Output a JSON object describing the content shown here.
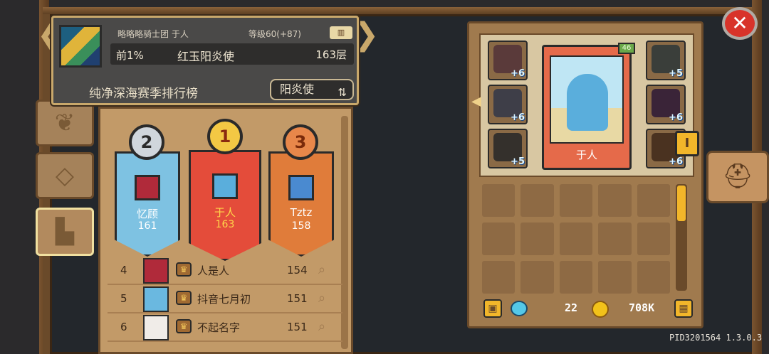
{
  "header": {
    "guild_player": "略略略骑士团 于人",
    "level": "等级60(+87)",
    "rank_percent": "前1%",
    "rank_title": "红玉阳炎使",
    "floor": "163层",
    "season_title": "纯净深海赛季排行榜",
    "class_button": "阳炎使"
  },
  "podium": [
    {
      "place": "2",
      "name": "忆顾",
      "score": "161"
    },
    {
      "place": "1",
      "name": "于人",
      "score": "163"
    },
    {
      "place": "3",
      "name": "Tztz",
      "score": "158"
    }
  ],
  "rows": [
    {
      "rank": "4",
      "name": "人是人",
      "score": "154"
    },
    {
      "rank": "5",
      "name": "抖音七月初",
      "score": "151"
    },
    {
      "rank": "6",
      "name": "不起名字",
      "score": "151"
    }
  ],
  "equipment": {
    "hero_name": "于人",
    "hero_badge": "46",
    "slots_left": [
      "+6",
      "+6",
      "+5"
    ],
    "slots_right": [
      "+5",
      "+6",
      "+6"
    ],
    "side_tag": "I"
  },
  "currency": {
    "gems": "22",
    "coins": "708K"
  },
  "version": "PID3201564 1.3.0.3",
  "colors": {
    "gold": "#f2b62a",
    "wood": "#6a4a2a",
    "close_red": "#d8332a"
  },
  "icons": {
    "tab1": "leaf-icon",
    "tab2": "diamond-icon",
    "tab3": "podium-icon",
    "helmet": "helmet-icon",
    "close": "close-icon"
  }
}
